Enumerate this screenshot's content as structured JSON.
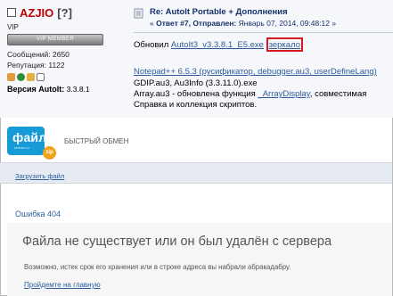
{
  "forum": {
    "username": "AZJIO",
    "user_status": "[?]",
    "rank": "VIP",
    "badge_text": "VIP MEMBER",
    "posts": "Сообщений: 2650",
    "reputation": "Репутация: 1122",
    "version_label": "Версия AutoIt:",
    "version_value": "3.3.8.1",
    "post_title": "Re: AutoIt Portable + Дополнения",
    "post_sub_prefix": "« ",
    "post_reply": "Ответ #7,",
    "post_sent_label": "Отправлен:",
    "post_sent_date": "Январь 07, 2014, 09:48:12",
    "post_sub_suffix": " »",
    "line1_prefix": "Обновил ",
    "line1_link": "AutoIt3_v3.3.8.1_E5.exe",
    "line1_mirror": "зеркало",
    "line2": "Notepad++ 6.5.3 (русификатор, debugger.au3, userDefineLang)",
    "line3": "GDIP.au3, Au3Info (3.3.11.0).exe",
    "line4_prefix": "Array.au3 - обновлена функция ",
    "line4_link": "_ArrayDisplay",
    "line4_suffix": ", совместимая",
    "line5": "Справка и коллекция скриптов.",
    "colors": {
      "username": "#c00000",
      "title": "#15316b",
      "link": "#2e5d9e",
      "highlight": "#d7191b"
    }
  },
  "filehost": {
    "logo_word": "файл",
    "logo_small": "sharez.ru",
    "logo_badge": "zip",
    "tagline": "БЫСТРЫЙ ОБМЕН",
    "upload_link": "Загрузить файл",
    "error_title": "Ошибка 404",
    "heading": "Файла не существует или он был удалён с сервера",
    "text": "Возможно, истек срок его хранения или в строке адреса вы набрали абракадабру.",
    "home_link": "Пройдемте на главную",
    "colors": {
      "brand": "#179bd7",
      "accent": "#f0a21d"
    }
  }
}
